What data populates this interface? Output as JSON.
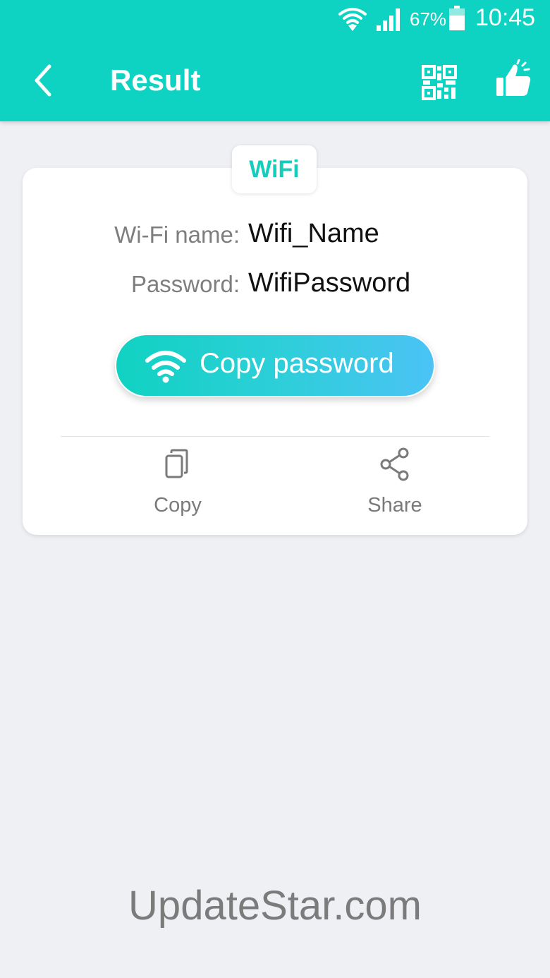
{
  "status_bar": {
    "battery_percent": "67%",
    "time": "10:45"
  },
  "header": {
    "title": "Result",
    "icons": [
      "back-arrow-icon",
      "qr-code-icon",
      "thumbs-up-icon"
    ]
  },
  "card": {
    "type_tag": "WiFi",
    "fields": [
      {
        "label": "Wi-Fi name:",
        "value": "Wifi_Name"
      },
      {
        "label": "Password:",
        "value": "WifiPassword"
      }
    ],
    "primary_button": "Copy password",
    "actions": [
      {
        "label": "Copy",
        "icon": "copy-icon"
      },
      {
        "label": "Share",
        "icon": "share-icon"
      }
    ]
  },
  "watermark": "UpdateStar.com",
  "colors": {
    "header": "#0fd3c2",
    "accent": "#15cdbb",
    "background": "#eff0f4"
  }
}
